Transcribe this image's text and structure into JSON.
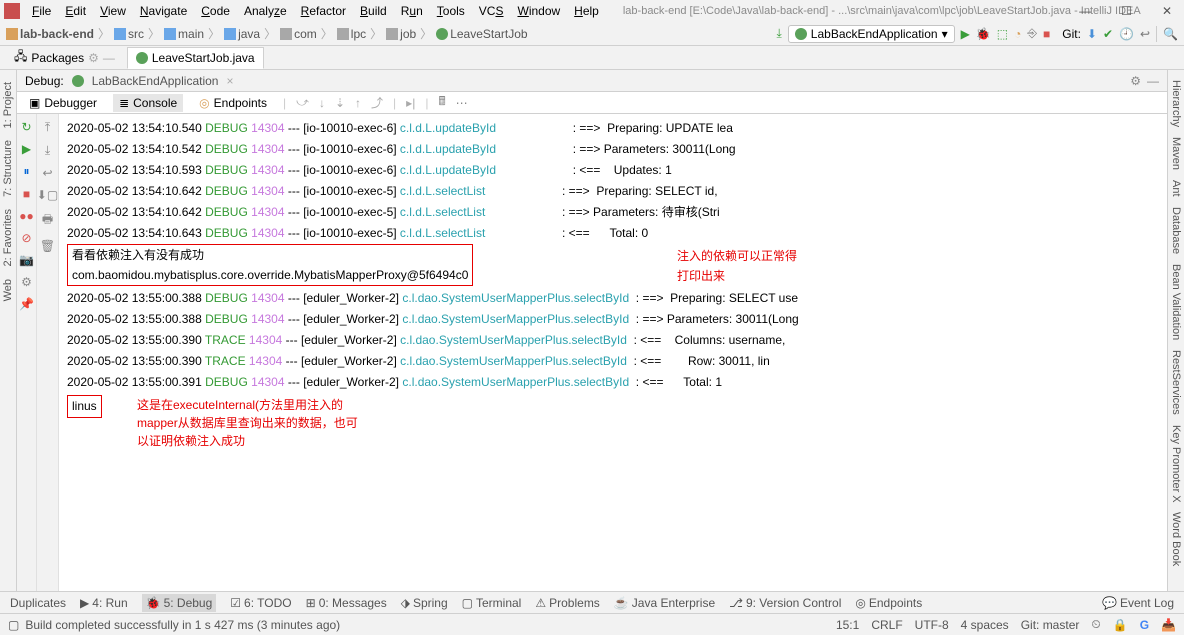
{
  "menu": {
    "file": "File",
    "edit": "Edit",
    "view": "View",
    "navigate": "Navigate",
    "code": "Code",
    "analyze": "Analyze",
    "refactor": "Refactor",
    "build": "Build",
    "run": "Run",
    "tools": "Tools",
    "vcs": "VCS",
    "window": "Window",
    "help": "Help",
    "path": "lab-back-end [E:\\Code\\Java\\lab-back-end] - ...\\src\\main\\java\\com\\lpc\\job\\LeaveStartJob.java - IntelliJ IDEA"
  },
  "crumbs": [
    "lab-back-end",
    "src",
    "main",
    "java",
    "com",
    "lpc",
    "job",
    "LeaveStartJob"
  ],
  "run_config": "LabBackEndApplication",
  "git_label": "Git:",
  "tabs": {
    "packages": "Packages",
    "active": "LeaveStartJob.java"
  },
  "left_tabs": [
    "1: Project"
  ],
  "right_tabs": [
    "Hierarchy",
    "Maven",
    "Ant",
    "Database",
    "Bean Validation",
    "RestServices",
    "Key Promoter X",
    "Word Book"
  ],
  "debug": {
    "label": "Debug:",
    "config": "LabBackEndApplication",
    "tabs": {
      "debugger": "Debugger",
      "console": "Console",
      "endpoints": "Endpoints"
    }
  },
  "log": [
    {
      "ts": "2020-05-02 13:54:10.540",
      "lvl": "DEBUG",
      "pid": "14304",
      "thr": "[io-10010-exec-6]",
      "logger": "c.l.d.L.updateById",
      "sep": ": ==>",
      "msg": " Preparing: UPDATE lea"
    },
    {
      "ts": "2020-05-02 13:54:10.542",
      "lvl": "DEBUG",
      "pid": "14304",
      "thr": "[io-10010-exec-6]",
      "logger": "c.l.d.L.updateById",
      "sep": ": ==>",
      "msg": "Parameters: 30011(Long"
    },
    {
      "ts": "2020-05-02 13:54:10.593",
      "lvl": "DEBUG",
      "pid": "14304",
      "thr": "[io-10010-exec-6]",
      "logger": "c.l.d.L.updateById",
      "sep": ": <==",
      "msg": "   Updates: 1"
    },
    {
      "ts": "2020-05-02 13:54:10.642",
      "lvl": "DEBUG",
      "pid": "14304",
      "thr": "[io-10010-exec-5]",
      "logger": "c.l.d.L.selectList",
      "sep": ": ==>",
      "msg": " Preparing: SELECT id,"
    },
    {
      "ts": "2020-05-02 13:54:10.642",
      "lvl": "DEBUG",
      "pid": "14304",
      "thr": "[io-10010-exec-5]",
      "logger": "c.l.d.L.selectList",
      "sep": ": ==>",
      "msg": "Parameters: 待审核(Stri"
    },
    {
      "ts": "2020-05-02 13:54:10.643",
      "lvl": "DEBUG",
      "pid": "14304",
      "thr": "[io-10010-exec-5]",
      "logger": "c.l.d.L.selectList",
      "sep": ": <==",
      "msg": "     Total: 0"
    }
  ],
  "annot": {
    "line1": "看看依赖注入有没有成功",
    "line2": "com.baomidou.mybatisplus.core.override.MybatisMapperProxy@5f6494c0",
    "r1": "注入的依赖可以正常得",
    "r2": "打印出来"
  },
  "log2": [
    {
      "ts": "2020-05-02 13:55:00.388",
      "lvl": "DEBUG",
      "pid": "14304",
      "thr": "[eduler_Worker-2]",
      "logger": "c.l.dao.SystemUserMapperPlus.selectById",
      "sep": ": ==>",
      "msg": " Preparing: SELECT use"
    },
    {
      "ts": "2020-05-02 13:55:00.388",
      "lvl": "DEBUG",
      "pid": "14304",
      "thr": "[eduler_Worker-2]",
      "logger": "c.l.dao.SystemUserMapperPlus.selectById",
      "sep": ": ==>",
      "msg": "Parameters: 30011(Long"
    },
    {
      "ts": "2020-05-02 13:55:00.390",
      "lvl": "TRACE",
      "pid": "14304",
      "thr": "[eduler_Worker-2]",
      "logger": "c.l.dao.SystemUserMapperPlus.selectById",
      "sep": ": <==",
      "msg": "   Columns: username, "
    },
    {
      "ts": "2020-05-02 13:55:00.390",
      "lvl": "TRACE",
      "pid": "14304",
      "thr": "[eduler_Worker-2]",
      "logger": "c.l.dao.SystemUserMapperPlus.selectById",
      "sep": ": <==",
      "msg": "       Row: 30011, lin"
    },
    {
      "ts": "2020-05-02 13:55:00.391",
      "lvl": "DEBUG",
      "pid": "14304",
      "thr": "[eduler_Worker-2]",
      "logger": "c.l.dao.SystemUserMapperPlus.selectById",
      "sep": ": <==",
      "msg": "     Total: 1"
    }
  ],
  "annot2": {
    "box": "linus",
    "l1": "这是在executeInternal(方法里用注入的",
    "l2": "mapper从数据库里查询出来的数据，也可",
    "l3": "以证明依赖注入成功"
  },
  "tool": {
    "dup": "Duplicates",
    "run": "4: Run",
    "debug": "5: Debug",
    "todo": "6: TODO",
    "msg": "0: Messages",
    "spring": "Spring",
    "term": "Terminal",
    "prob": "Problems",
    "ent": "Java Enterprise",
    "vc": "9: Version Control",
    "ep": "Endpoints",
    "elog": "Event Log"
  },
  "status": {
    "build": "Build completed successfully in 1 s 427 ms (3 minutes ago)",
    "pos": "15:1",
    "eol": "CRLF",
    "enc": "UTF-8",
    "indent": "4 spaces",
    "git": "Git: master"
  }
}
